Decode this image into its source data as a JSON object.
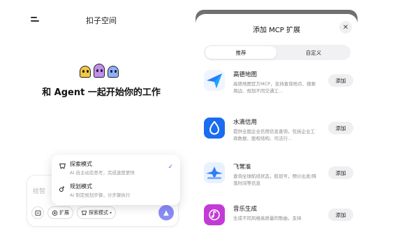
{
  "left": {
    "title": "扣子空间",
    "headline": "和 Agent 一起开始你的工作",
    "input_placeholder": "给智",
    "toolbar": {
      "ext_label": "扩展",
      "mode_label": "探索模式"
    }
  },
  "mode_menu": [
    {
      "name": "探索模式",
      "desc": "AI 自主动态思考，完成速度更快",
      "selected": true
    },
    {
      "name": "规划模式",
      "desc": "AI 制定规划步骤，分步骤执行"
    }
  ],
  "sheet": {
    "title": "添加 MCP 扩展",
    "tabs": [
      "推荐",
      "自定义"
    ],
    "extensions": [
      {
        "name": "高德地图",
        "desc": "高德地图官方MCP，支持查询地点、搜索周边、规划不同交通工…",
        "add_label": "添加",
        "icon": "map-pin-icon",
        "color": "#2b7bff"
      },
      {
        "name": "水滴信用",
        "desc": "提供全国企业信用信息查询，包括企业工商数据、股权结构、司法行…",
        "add_label": "添加",
        "icon": "water-drop-icon",
        "color": "#1a6cf0"
      },
      {
        "name": "飞常准",
        "desc": "查询全球航班状态，航班号，预计出发/降落时间等信息",
        "add_label": "添加",
        "icon": "airplane-icon",
        "color": "#2f7ff0"
      },
      {
        "name": "音乐生成",
        "desc": "生成不同风格高质量的歌曲，支持",
        "add_label": "添加",
        "icon": "music-note-icon",
        "color": "#c23bd6"
      }
    ]
  }
}
